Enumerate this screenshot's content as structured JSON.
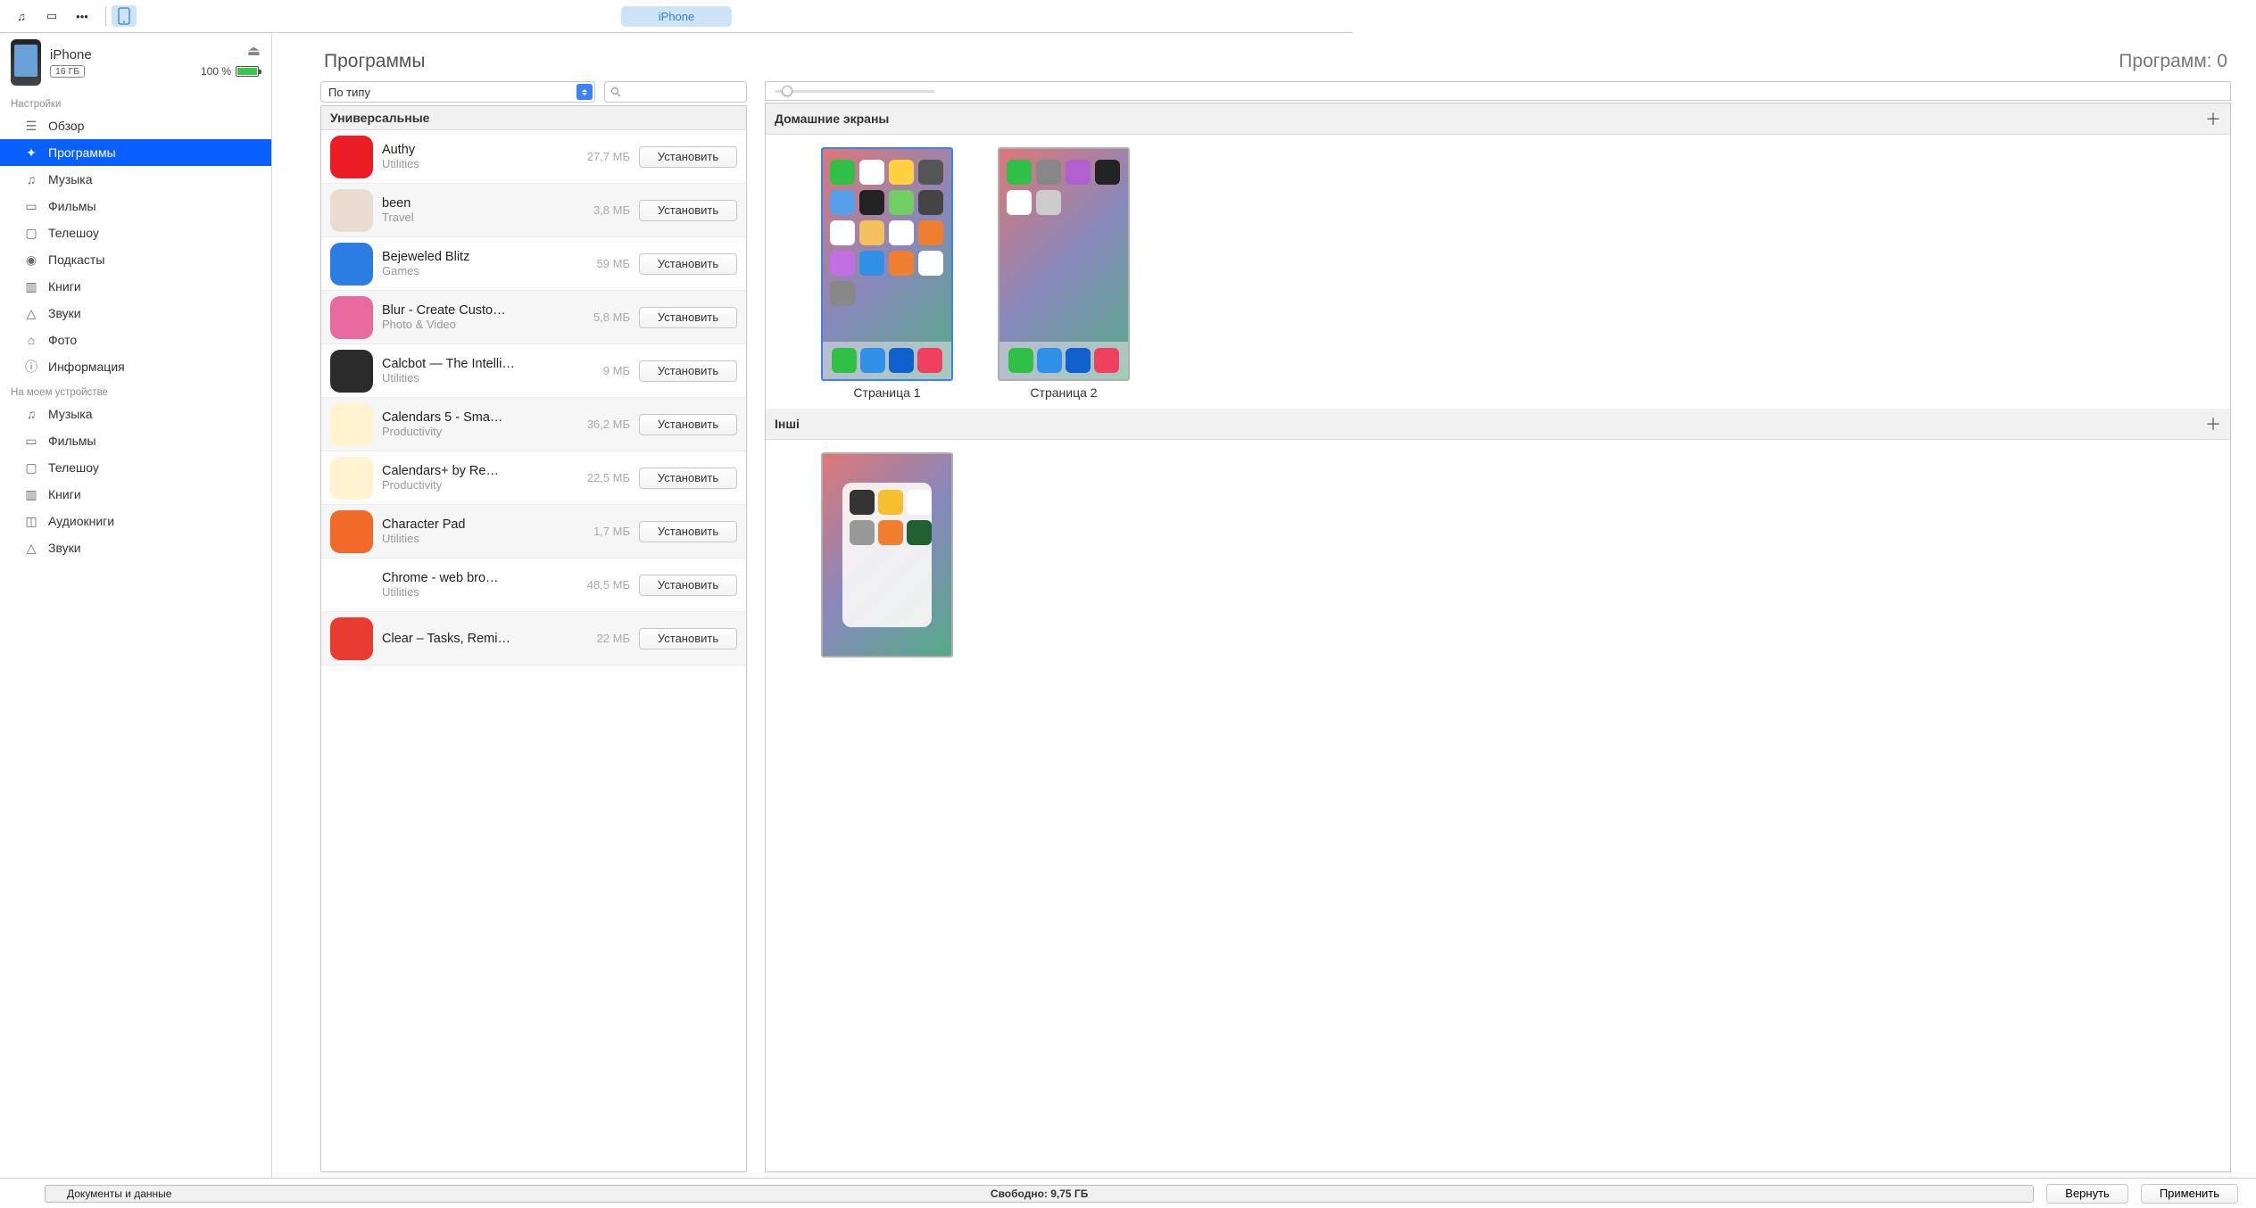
{
  "toolbar": {
    "device_label": "iPhone"
  },
  "device": {
    "name": "iPhone",
    "capacity": "16 ГБ",
    "battery": "100 %"
  },
  "sidebar": {
    "group1_label": "Настройки",
    "items1": [
      {
        "label": "Обзор"
      },
      {
        "label": "Программы"
      },
      {
        "label": "Музыка"
      },
      {
        "label": "Фильмы"
      },
      {
        "label": "Телешоу"
      },
      {
        "label": "Подкасты"
      },
      {
        "label": "Книги"
      },
      {
        "label": "Звуки"
      },
      {
        "label": "Фото"
      },
      {
        "label": "Информация"
      }
    ],
    "group2_label": "На моем устройстве",
    "items2": [
      {
        "label": "Музыка"
      },
      {
        "label": "Фильмы"
      },
      {
        "label": "Телешоу"
      },
      {
        "label": "Книги"
      },
      {
        "label": "Аудиокниги"
      },
      {
        "label": "Звуки"
      }
    ]
  },
  "main": {
    "title": "Программы",
    "count_label": "Программ: 0",
    "sort_label": "По типу",
    "list_header": "Универсальные",
    "install_label": "Установить",
    "apps": [
      {
        "name": "Authy",
        "cat": "Utilities",
        "size": "27,7 МБ",
        "color": "#ec1c24"
      },
      {
        "name": "been",
        "cat": "Travel",
        "size": "3,8 МБ",
        "color": "#e8ddd0"
      },
      {
        "name": "Bejeweled Blitz",
        "cat": "Games",
        "size": "59 МБ",
        "color": "#2b7de3"
      },
      {
        "name": "Blur - Create Custo…",
        "cat": "Photo & Video",
        "size": "5,8 МБ",
        "color": "#e86aa0"
      },
      {
        "name": "Calcbot — The Intelli…",
        "cat": "Utilities",
        "size": "9 МБ",
        "color": "#2b2b2b"
      },
      {
        "name": "Calendars 5 - Sma…",
        "cat": "Productivity",
        "size": "36,2 МБ",
        "color": "#fff3d0"
      },
      {
        "name": "Calendars+ by Re…",
        "cat": "Productivity",
        "size": "22,5 МБ",
        "color": "#fff3d0"
      },
      {
        "name": "Character Pad",
        "cat": "Utilities",
        "size": "1,7 МБ",
        "color": "#f26a2a"
      },
      {
        "name": "Chrome - web bro…",
        "cat": "Utilities",
        "size": "48,5 МБ",
        "color": "#ffffff"
      },
      {
        "name": "Clear – Tasks, Remi…",
        "cat": "",
        "size": "22 МБ",
        "color": "#e73c2f"
      }
    ]
  },
  "screens": {
    "section1": "Домашние экраны",
    "page1": "Страница 1",
    "page2": "Страница 2",
    "section2": "Інші"
  },
  "storage": {
    "docs_label": "Документы и данные",
    "free_label": "Свободно: 9,75 ГБ",
    "segments": [
      {
        "color": "#f95fa8",
        "width": "0.7%"
      },
      {
        "color": "#8fd94a",
        "width": "0.6%"
      },
      {
        "color": "#17c7b0",
        "width": "12%"
      },
      {
        "color": "#f6b73c",
        "width": "3.2%"
      }
    ]
  },
  "footer": {
    "revert": "Вернуть",
    "apply": "Применить"
  }
}
